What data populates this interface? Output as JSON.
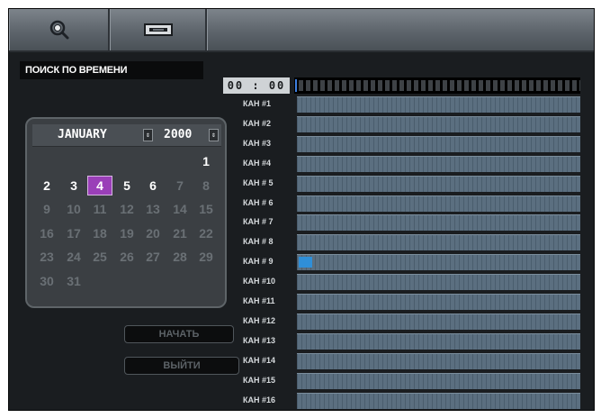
{
  "toolbar": {
    "search_icon": "search-icon",
    "device_icon": "recorder-icon"
  },
  "title": "ПОИСК ПО ВРЕМЕНИ",
  "calendar": {
    "month": "JANUARY",
    "year": "2000",
    "selected_day": 4,
    "days_with_recordings": [
      1,
      2,
      3,
      4,
      5,
      6
    ],
    "weeks": [
      [
        "",
        "",
        "",
        "",
        "",
        "",
        "1"
      ],
      [
        "2",
        "3",
        "4",
        "5",
        "6",
        "7",
        "8"
      ],
      [
        "9",
        "10",
        "11",
        "12",
        "13",
        "14",
        "15"
      ],
      [
        "16",
        "17",
        "18",
        "19",
        "20",
        "21",
        "22"
      ],
      [
        "23",
        "24",
        "25",
        "26",
        "27",
        "28",
        "29"
      ],
      [
        "30",
        "31",
        "",
        "",
        "",
        "",
        ""
      ]
    ]
  },
  "buttons": {
    "start": "НАЧАТЬ",
    "exit": "ВЫЙТИ"
  },
  "timeline": {
    "time": "00 : 00",
    "channels": [
      {
        "label": "КАН #1",
        "recording": false
      },
      {
        "label": "КАН #2",
        "recording": false
      },
      {
        "label": "КАН #3",
        "recording": false
      },
      {
        "label": "КАН #4",
        "recording": false
      },
      {
        "label": "КАН # 5",
        "recording": false
      },
      {
        "label": "КАН # 6",
        "recording": false
      },
      {
        "label": "КАН # 7",
        "recording": false
      },
      {
        "label": "КАН # 8",
        "recording": false
      },
      {
        "label": "КАН # 9",
        "recording": true
      },
      {
        "label": "КАН #10",
        "recording": false
      },
      {
        "label": "КАН #11",
        "recording": false
      },
      {
        "label": "КАН #12",
        "recording": false
      },
      {
        "label": "КАН #13",
        "recording": false
      },
      {
        "label": "КАН #14",
        "recording": false
      },
      {
        "label": "КАН #15",
        "recording": false
      },
      {
        "label": "КАН #16",
        "recording": false
      }
    ]
  },
  "colors": {
    "background": "#1a1d20",
    "selected_day": "#9a3fb8",
    "recording": "#2f8fd8",
    "track": "#5b6f80"
  }
}
